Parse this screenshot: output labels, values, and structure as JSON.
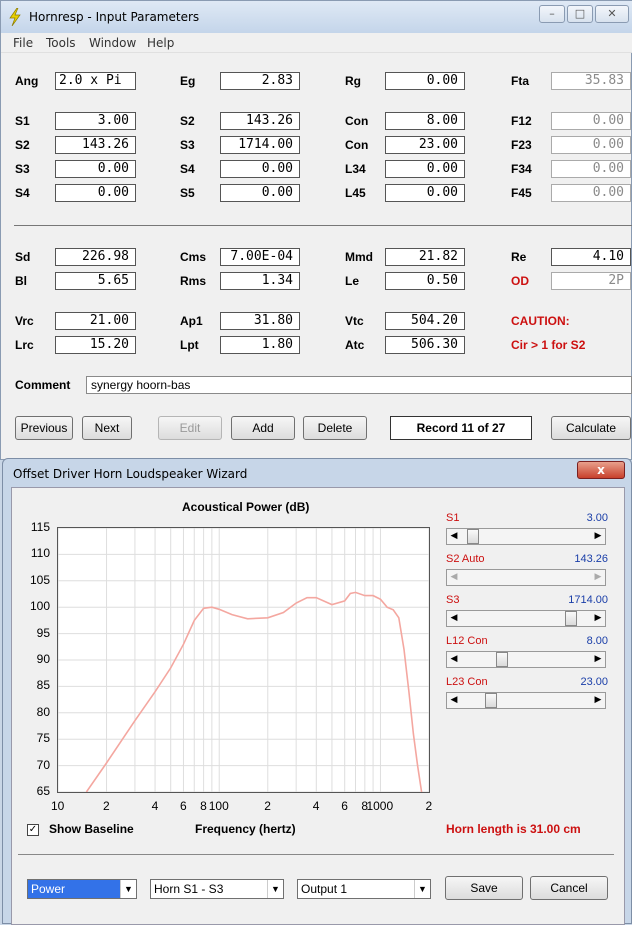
{
  "window": {
    "title": "Hornresp - Input Parameters"
  },
  "menu": [
    "File",
    "Tools",
    "Window",
    "Help"
  ],
  "params": {
    "ang_label": "Ang",
    "ang": "2.0 x Pi",
    "eg_label": "Eg",
    "eg": "2.83",
    "rg_label": "Rg",
    "rg": "0.00",
    "fta_label": "Fta",
    "fta": "35.83",
    "s1_label": "S1",
    "s1": "3.00",
    "s2_label_b": "S2",
    "s2b": "143.26",
    "con1_label": "Con",
    "con1": "8.00",
    "f12_label": "F12",
    "f12": "0.00",
    "s2_label": "S2",
    "s2": "143.26",
    "s3_label_b": "S3",
    "s3b": "1714.00",
    "con2_label": "Con",
    "con2": "23.00",
    "f23_label": "F23",
    "f23": "0.00",
    "s3_label": "S3",
    "s3": "0.00",
    "s4_label_b": "S4",
    "s4b": "0.00",
    "l34_label": "L34",
    "l34": "0.00",
    "f34_label": "F34",
    "f34": "0.00",
    "s4_label": "S4",
    "s4": "0.00",
    "s5_label": "S5",
    "s5": "0.00",
    "l45_label": "L45",
    "l45": "0.00",
    "f45_label": "F45",
    "f45": "0.00",
    "sd_label": "Sd",
    "sd": "226.98",
    "cms_label": "Cms",
    "cms": "7.00E-04",
    "mmd_label": "Mmd",
    "mmd": "21.82",
    "re_label": "Re",
    "re": "4.10",
    "bl_label": "Bl",
    "bl": "5.65",
    "rms_label": "Rms",
    "rms": "1.34",
    "le_label": "Le",
    "le": "0.50",
    "od_label": "OD",
    "od": "2P",
    "vrc_label": "Vrc",
    "vrc": "21.00",
    "ap1_label": "Ap1",
    "ap1": "31.80",
    "vtc_label": "Vtc",
    "vtc": "504.20",
    "caution": "CAUTION:",
    "lrc_label": "Lrc",
    "lrc": "15.20",
    "lpt_label": "Lpt",
    "lpt": "1.80",
    "atc_label": "Atc",
    "atc": "506.30",
    "caution_msg": "Cir > 1 for S2"
  },
  "comment": {
    "label": "Comment",
    "value": "synergy hoorn-bas"
  },
  "buttons": {
    "previous": "Previous",
    "next": "Next",
    "edit": "Edit",
    "add": "Add",
    "delete": "Delete",
    "record": "Record 11 of 27",
    "calculate": "Calculate"
  },
  "wizard": {
    "title": "Offset Driver Horn Loudspeaker Wizard",
    "close": "x",
    "sliders": [
      {
        "label": "S1",
        "value": "3.00",
        "level": 0.05
      },
      {
        "label": "S2  Auto",
        "value": "143.26",
        "level": 0.0
      },
      {
        "label": "S3",
        "value": "1714.00",
        "level": 0.88
      },
      {
        "label": "L12  Con",
        "value": "8.00",
        "level": 0.3
      },
      {
        "label": "L23  Con",
        "value": "23.00",
        "level": 0.2
      }
    ],
    "horn_length": "Horn length is 31.00 cm",
    "show_baseline": "Show Baseline",
    "dropdowns": [
      "Power",
      "Horn S1 - S3",
      "Output 1"
    ],
    "save": "Save",
    "cancel": "Cancel"
  },
  "chart_data": {
    "type": "line",
    "title": "Acoustical Power (dB)",
    "xlabel": "Frequency (hertz)",
    "ylabel": "",
    "x_scale": "log",
    "xlim": [
      10,
      2000
    ],
    "ylim": [
      65,
      115
    ],
    "yticks": [
      "115",
      "110",
      "105",
      "100",
      "95",
      "90",
      "85",
      "80",
      "75",
      "70",
      "65"
    ],
    "xticks": [
      "10",
      "2",
      "4",
      "6",
      "8",
      "100",
      "2",
      "4",
      "6",
      "8",
      "1000",
      "2"
    ],
    "grid": true,
    "color": "#f4a7a0",
    "series": [
      {
        "x": [
          15,
          20,
          30,
          40,
          50,
          60,
          70,
          80,
          90,
          100,
          120,
          150,
          200,
          250,
          300,
          350,
          400,
          500,
          600,
          650,
          700,
          800,
          900,
          1000,
          1100,
          1200,
          1300,
          1400,
          1500,
          1600,
          1700,
          1800
        ],
        "y": [
          65,
          70.5,
          78.5,
          84,
          88.5,
          93,
          97.5,
          99.8,
          100,
          99.6,
          98.6,
          97.8,
          98,
          99,
          100.8,
          101.8,
          101.8,
          100.5,
          101.2,
          102.6,
          102.8,
          102.2,
          102.2,
          101.5,
          100,
          99.5,
          98,
          92,
          84,
          76,
          70,
          65
        ]
      }
    ]
  }
}
